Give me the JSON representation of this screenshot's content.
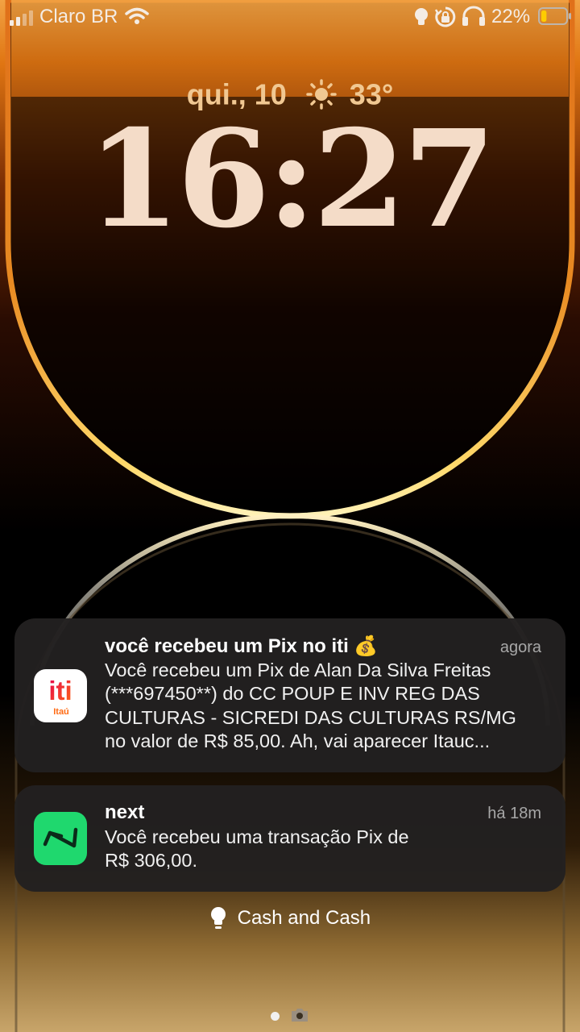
{
  "status_bar": {
    "carrier": "Claro BR",
    "battery_percent": "22%",
    "battery_level": 0.22,
    "icons": [
      "signal-icon",
      "wifi-icon",
      "flashlight-icon",
      "rotation-lock-icon",
      "headphones-icon",
      "battery-icon"
    ]
  },
  "lockscreen": {
    "date": "qui., 10",
    "weather_icon": "sun-icon",
    "temperature": "33°",
    "time": "16:27"
  },
  "notifications": [
    {
      "app_icon": "iti-itau-app-icon",
      "icon_text": "iti",
      "icon_subtext": "Itaú",
      "title": "você recebeu um Pix no iti 💰",
      "time": "agora",
      "body_lines": [
        "Você recebeu um Pix de Alan Da Silva Freitas",
        "(***697450**) do CC POUP E INV REG DAS",
        "CULTURAS - SICREDI DAS CULTURAS RS/MG",
        "no valor de R$ 85,00. Ah, vai aparecer Itauc..."
      ]
    },
    {
      "app_icon": "next-app-icon",
      "title": "next",
      "time": "há 18m",
      "body_lines": [
        "Você recebeu uma transação Pix de",
        "R$ 306,00."
      ]
    }
  ],
  "focus": {
    "icon": "lightbulb-icon",
    "label": "Cash and Cash"
  },
  "colors": {
    "accent_orange": "#f08a1c",
    "ring_gold": "#ffd45a",
    "notification_bg": "#222020",
    "iti_orange": "#ff6b14",
    "iti_pink": "#e5004f",
    "next_green": "#1fd86e"
  }
}
